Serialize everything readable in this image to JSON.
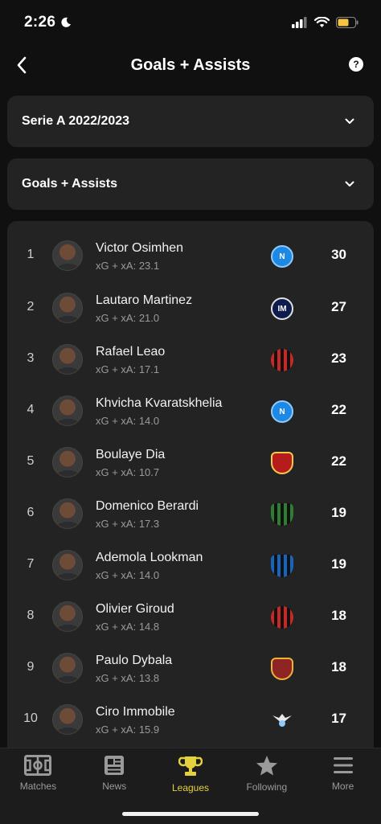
{
  "status_bar": {
    "time": "2:26"
  },
  "header": {
    "title": "Goals + Assists",
    "help_label": "?"
  },
  "filters": {
    "league": "Serie A 2022/2023",
    "stat": "Goals + Assists"
  },
  "players": [
    {
      "rank": "1",
      "name": "Victor Osimhen",
      "xg": "xG + xA: 23.1",
      "value": "30",
      "club_color": "#1e88e5"
    },
    {
      "rank": "2",
      "name": "Lautaro Martinez",
      "xg": "xG + xA: 21.0",
      "value": "27",
      "club_color": "#1a237e"
    },
    {
      "rank": "3",
      "name": "Rafael Leao",
      "xg": "xG + xA: 17.1",
      "value": "23",
      "club_color": "#c62828"
    },
    {
      "rank": "4",
      "name": "Khvicha Kvaratskhelia",
      "xg": "xG + xA: 14.0",
      "value": "22",
      "club_color": "#1e88e5"
    },
    {
      "rank": "5",
      "name": "Boulaye Dia",
      "xg": "xG + xA: 10.7",
      "value": "22",
      "club_color": "#b71c1c"
    },
    {
      "rank": "6",
      "name": "Domenico Berardi",
      "xg": "xG + xA: 17.3",
      "value": "19",
      "club_color": "#2e7d32"
    },
    {
      "rank": "7",
      "name": "Ademola Lookman",
      "xg": "xG + xA: 14.0",
      "value": "19",
      "club_color": "#1565c0"
    },
    {
      "rank": "8",
      "name": "Olivier Giroud",
      "xg": "xG + xA: 14.8",
      "value": "18",
      "club_color": "#c62828"
    },
    {
      "rank": "9",
      "name": "Paulo Dybala",
      "xg": "xG + xA: 13.8",
      "value": "18",
      "club_color": "#8e2424"
    },
    {
      "rank": "10",
      "name": "Ciro Immobile",
      "xg": "xG + xA: 15.9",
      "value": "17",
      "club_color": "#64b5f6"
    }
  ],
  "tabs": [
    {
      "label": "Matches",
      "icon": "pitch-icon",
      "active": false
    },
    {
      "label": "News",
      "icon": "news-icon",
      "active": false
    },
    {
      "label": "Leagues",
      "icon": "trophy-icon",
      "active": true
    },
    {
      "label": "Following",
      "icon": "star-icon",
      "active": false
    },
    {
      "label": "More",
      "icon": "menu-icon",
      "active": false
    }
  ],
  "colors": {
    "accent": "#e3d23d",
    "background": "#101010",
    "card": "#232323"
  }
}
